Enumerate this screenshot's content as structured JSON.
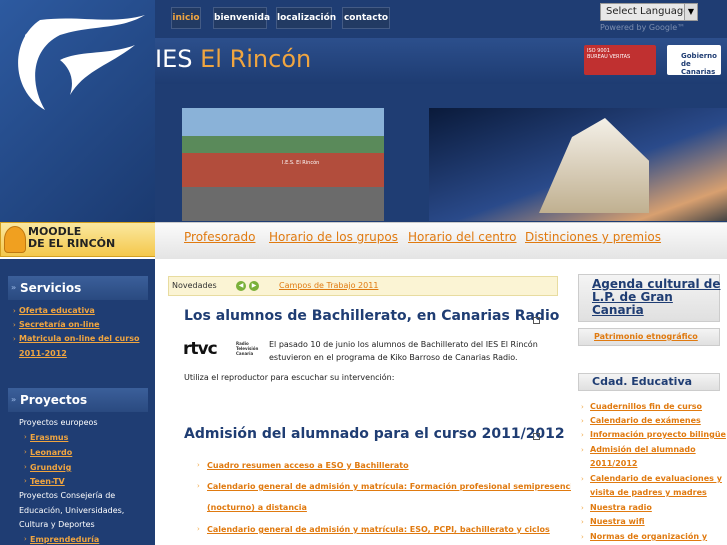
{
  "site": {
    "title_part1": "IES ",
    "title_part2": "El Rincón"
  },
  "nav": [
    "inicio",
    "bienvenida",
    "localización",
    "contacto"
  ],
  "language": {
    "label": "Select Language",
    "powered": "Powered by Google™"
  },
  "badges": {
    "cert1": "ISO 9001",
    "cert2": "BUREAU VERITAS",
    "gobierno_line1": "Gobierno",
    "gobierno_line2": "de Canarias"
  },
  "photo_sign": "I.E.S. El Rincón",
  "top_links": [
    "Profesorado",
    "Horario de los grupos",
    "Horario del centro",
    "Distinciones y premios"
  ],
  "moodle": {
    "line1": "MOODLE",
    "line2": "DE EL RINCÓN"
  },
  "sidebar": {
    "servicios_title": "Servicios",
    "servicios": [
      "Oferta educativa",
      "Secretaría on-line",
      "Matricula on-line del curso",
      "2011-2012"
    ],
    "proyectos_title": "Proyectos",
    "proyectos_europeos": "Proyectos europeos",
    "europeos": [
      "Erasmus",
      "Leonardo",
      "Grundvig",
      "Teen-TV"
    ],
    "consejeria": [
      "Proyectos Consejería de",
      "Educación, Universidades,",
      "Cultura y Deportes"
    ],
    "emprendeduria": "Emprendeduría"
  },
  "news": {
    "label": "Novedades",
    "link": "Campos de Trabajo 2011"
  },
  "article1": {
    "title": "Los alumnos de Bachillerato, en Canarias Radio",
    "logo": "rtvc",
    "logo_sub": [
      "Radio",
      "Televisión",
      "Canaria"
    ],
    "text1": "El pasado 10 de junio los alumnos de Bachillerato del IES El Rincón",
    "text2": "estuvieron en el programa de Kiko Barroso de Canarias Radio.",
    "text3": "Utiliza el reproductor para escuchar su intervención:"
  },
  "article2": {
    "title": "Admisión del alumnado para el curso 2011/2012",
    "links": [
      "Cuadro resumen acceso a ESO y Bachillerato",
      "Calendario general de admisión y matrícula: Formación profesional semipresencial",
      "(nocturno) a distancia",
      "Calendario general de admisión y matrícula: ESO, PCPI, bachillerato y ciclos"
    ]
  },
  "right": {
    "agenda_title": [
      "Agenda cultural de",
      "L.P. de Gran",
      "Canaria"
    ],
    "agenda_link": "Patrimonio etnográfico",
    "cdad_title": "Cdad. Educativa",
    "cdad_links": [
      "Cuadernillos fin de curso",
      "Calendario de exámenes",
      "Información proyecto bilingüe",
      "Admisión del alumnado",
      "2011/2012",
      "Calendario de evaluaciones y",
      "visita de padres y madres",
      "Nuestra radio",
      "Nuestra wifi",
      "Normas de organización y"
    ]
  },
  "colors": {
    "brand": "#1f3d73",
    "accent": "#e07a10",
    "highlight": "#f0a540"
  }
}
